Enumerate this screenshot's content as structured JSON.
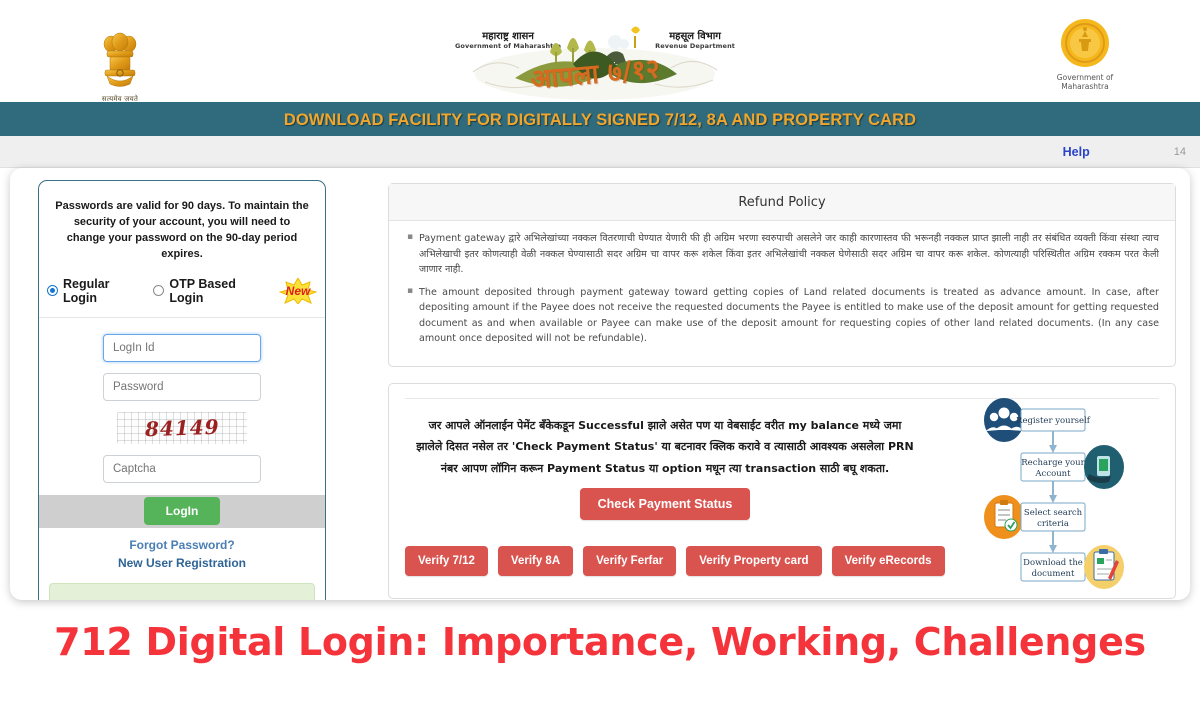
{
  "header": {
    "emblem_left": {
      "icon": "ashoka-lion-capital-emblem",
      "caption": "सत्यमेव जयते"
    },
    "brand": {
      "left_mr": "महाराष्ट्र शासन",
      "left_en": "Government of Maharashtra",
      "right_mr": "महसूल विभाग",
      "right_en": "Revenue Department",
      "wordmark": "आपला ७/१२"
    },
    "emblem_right": {
      "icon": "government-of-maharashtra-seal",
      "caption": "Government of\nMaharashtra"
    }
  },
  "banner": {
    "text": "DOWNLOAD FACILITY FOR DIGITALLY SIGNED 7/12, 8A AND PROPERTY CARD"
  },
  "utilbar": {
    "help_label": "Help",
    "counter": "14"
  },
  "login": {
    "password_notice": "Passwords are valid for 90 days. To maintain the security of your account, you will need to change your password on the 90-day period expires.",
    "mode_regular": "Regular Login",
    "mode_otp": "OTP Based Login",
    "new_badge": "New",
    "login_id_placeholder": "LogIn Id",
    "login_id_value": "",
    "password_placeholder": "Password",
    "password_value": "",
    "captcha_code": "84149",
    "captcha_placeholder": "Captcha",
    "captcha_value": "",
    "login_button": "LogIn",
    "forgot_password": "Forgot Password?",
    "new_user_registration": "New User Registration"
  },
  "refund_policy": {
    "title": "Refund Policy",
    "items": [
      "Payment gateway द्वारे अभिलेखांच्या नक्कल वितरणाची घेण्यात येणारी फी ही अग्रिम भरणा स्वरुपाची असलेने जर काही कारणास्तव फी भरूनही नक्कल प्राप्त झाली नाही तर संबंधित व्यक्ती किंवा संस्था त्याच अभिलेखाची इतर कोणत्याही वेळी नक्कल घेण्यासाठी सदर अग्रिम चा वापर करू शकेल किंवा इतर अभिलेखांची नक्कल घेणेसाठी सदर अग्रिम चा वापर करू शकेल. कोणत्याही परिस्थितीत अग्रिम रक्कम परत केली जाणार नाही.",
      "The amount deposited through payment gateway toward getting copies of Land related documents is treated as advance amount. In case, after depositing amount if the Payee does not receive the requested documents the Payee is entitled to make use of the deposit amount for getting requested document as and when available or Payee can make use of the deposit amount for requesting copies of other land related documents. (In any case amount once deposited will not be refundable)."
    ]
  },
  "payment_notice": {
    "line1": "जर आपले ऑनलाईन पेमेंट बँकेकडून Successful झाले असेत पण या वेबसाईट वरीत my balance मध्ये जमा",
    "line2": "झालेले दिसत नसेल तर 'Check Payment Status' या बटनावर क्लिक करावे व त्यासाठी आवश्यक असलेला PRN",
    "line3": "नंबर आपण लॉगिन करून Payment Status या option मधून त्या transaction साठी बघू शकता.",
    "check_status_button": "Check Payment Status"
  },
  "verify_buttons": [
    {
      "label": "Verify 7/12"
    },
    {
      "label": "Verify 8A"
    },
    {
      "label": "Verify Ferfar"
    },
    {
      "label": "Verify Property card"
    },
    {
      "label": "Verify eRecords"
    }
  ],
  "flow": {
    "steps": [
      {
        "label": "Register yourself",
        "icon": "people-group-icon"
      },
      {
        "label": "Recharge your Account",
        "icon": "mobile-payment-icon"
      },
      {
        "label": "Select search criteria",
        "icon": "clipboard-check-icon"
      },
      {
        "label": "Download the document",
        "icon": "document-pen-icon"
      }
    ]
  },
  "bottom_title": "712 Digital Login: Importance, Working, Challenges",
  "colors": {
    "banner_bg": "#2f6b7c",
    "banner_text": "#f0a62c",
    "accent_red": "#d9534f",
    "login_green": "#55b359",
    "link_blue": "#4a7fb5",
    "title_red": "#f5333a",
    "captcha_red": "#9b2020"
  }
}
